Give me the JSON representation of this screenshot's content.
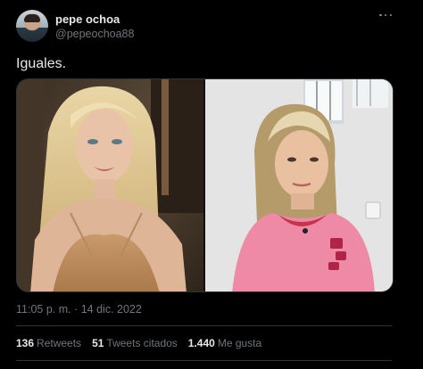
{
  "author": {
    "display_name": "pepe ochoa",
    "handle": "@pepeochoa88"
  },
  "tweet": {
    "text": "Iguales.",
    "timestamp": "11:05 p. m. · 14 dic. 2022"
  },
  "stats": [
    {
      "count": "136",
      "label": "Retweets"
    },
    {
      "count": "51",
      "label": "Tweets citados"
    },
    {
      "count": "1.440",
      "label": "Me gusta"
    }
  ],
  "icons": {
    "more": "more-options-icon"
  },
  "colors": {
    "background": "#000000",
    "text_primary": "#e7e9ea",
    "text_secondary": "#71767b",
    "border": "#2f3336"
  }
}
